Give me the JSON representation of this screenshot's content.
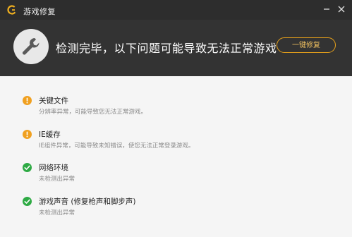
{
  "window": {
    "title": "游戏修复",
    "accent_color": "#e7a11a",
    "success_color": "#2eaa44",
    "warning_color": "#f0a020"
  },
  "header": {
    "headline": "检测完毕，以下问题可能导致无法正常游戏",
    "fix_button_label": "一键修复",
    "icon": "wrench-icon"
  },
  "items": [
    {
      "title": "关键文件",
      "desc": "分辨率异常，可能导致您无法正常游戏。",
      "status": "warning"
    },
    {
      "title": "IE缓存",
      "desc": "IE组件异常，可能导致未知错误，使您无法正常登录游戏。",
      "status": "warning"
    },
    {
      "title": "网络环境",
      "desc": "未检测出异常",
      "status": "ok"
    },
    {
      "title": "游戏声音 (修复枪声和脚步声)",
      "desc": "未检测出异常",
      "status": "ok"
    }
  ]
}
